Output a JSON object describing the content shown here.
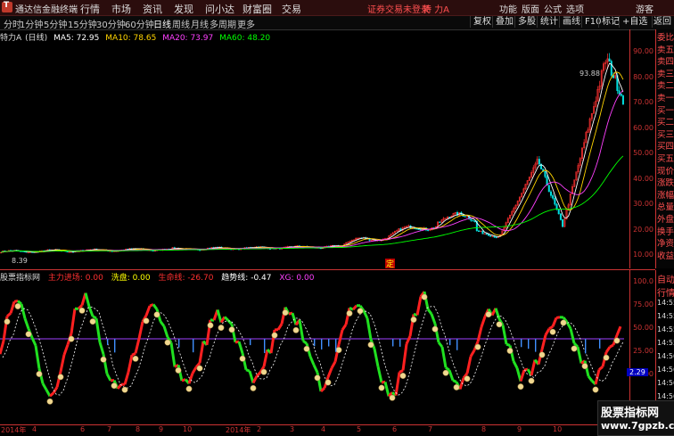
{
  "app": {
    "title": "通达信金融终端",
    "login_hint": "证券交易未登录",
    "stock_hint": "特 力A"
  },
  "menu": [
    "行情",
    "市场",
    "资讯",
    "发现",
    "问小达",
    "财富圈",
    "交易"
  ],
  "right_menu": [
    "功能",
    "版面",
    "公式",
    "选项",
    "游客"
  ],
  "periods": [
    "分时",
    "1分钟",
    "5分钟",
    "15分钟",
    "30分钟",
    "60分钟",
    "日线",
    "周线",
    "月线",
    "多周期",
    "更多"
  ],
  "active_period": "日线",
  "tools": [
    "复权",
    "叠加",
    "多股",
    "统计",
    "画线",
    "F10",
    "标记",
    "+自选",
    "返回"
  ],
  "stock": {
    "label": "特力A",
    "cycle": "(日线)"
  },
  "ma": [
    {
      "label": "MA5: 72.95",
      "color": "#ffffff"
    },
    {
      "label": "MA10: 78.65",
      "color": "#ffd400"
    },
    {
      "label": "MA20: 73.97",
      "color": "#ff40ff"
    },
    {
      "label": "MA60: 48.20",
      "color": "#00ff00"
    }
  ],
  "price_axis": [
    "90.00",
    "80.00",
    "70.00",
    "60.00",
    "50.00",
    "40.00",
    "30.00",
    "20.00",
    "10.00"
  ],
  "max_price_label": "93.88",
  "min_price_label": "8.39",
  "ding_label": "定",
  "quote_labels": [
    "委比",
    "卖五",
    "卖四",
    "卖三",
    "卖二",
    "卖一",
    "买一",
    "买二",
    "买三",
    "买四",
    "买五",
    "现价",
    "涨跌",
    "涨幅",
    "总量",
    "外盘",
    "换手",
    "净资",
    "收益"
  ],
  "indicator": {
    "name": "股票指标网",
    "fields": [
      {
        "label": "主力进场: 0.00",
        "color": "#ff3030"
      },
      {
        "label": "洗盘: 0.00",
        "color": "#ffff00"
      },
      {
        "label": "生命线: -26.70",
        "color": "#ff3030"
      },
      {
        "label": "趋势线: -0.47",
        "color": "#ffffff"
      },
      {
        "label": "XG: 0.00",
        "color": "#ff40ff"
      }
    ],
    "axis": [
      "100.0",
      "75.00",
      "50.00",
      "25.00",
      "0.00"
    ],
    "value_badge": "2.29"
  },
  "ind_panel_labels": [
    "自动",
    "行情",
    "14:55",
    "14:55",
    "14:55",
    "14:55",
    "14:56",
    "14:56",
    "14:56",
    "14:56",
    "14:56"
  ],
  "xaxis": [
    "2014年",
    "4",
    "6",
    "7",
    "8",
    "9",
    "10",
    "2014年",
    "2",
    "3",
    "4",
    "5",
    "6",
    "7",
    "8",
    "9",
    "10"
  ],
  "watermark": {
    "top": "股票指标网",
    "bottom": "www.7gpzb.com"
  }
}
